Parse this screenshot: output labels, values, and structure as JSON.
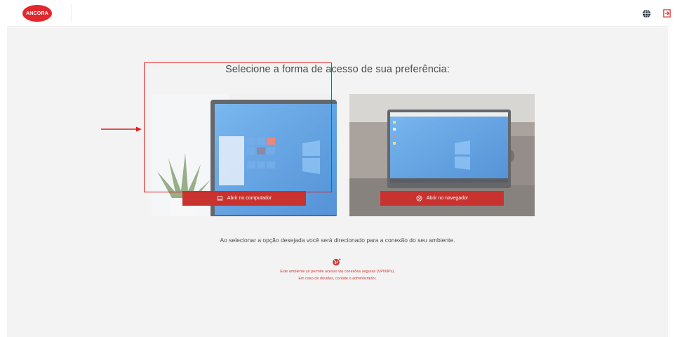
{
  "header": {
    "logo_text": "ANCORA",
    "language_icon": "globe-icon",
    "logout_icon": "logout-icon"
  },
  "main": {
    "heading": "Selecione a forma de acesso de sua preferência:",
    "options": [
      {
        "button_label": "Abrir no computador",
        "icon": "laptop-icon",
        "selected": true
      },
      {
        "button_label": "Abrir no navegador",
        "icon": "browser-globe-icon",
        "selected": false
      }
    ],
    "info_text": "Ao selecionar a opção desejada você será direcionado para a conexão do seu ambiente.",
    "warning_icon": "vpn-globe-icon",
    "warning_line1": "Este ambiente só permite acesso via conexões seguras (VPN/IPs).",
    "warning_line2": "Em caso de dúvidas, contate o administrador."
  },
  "colors": {
    "brand_red": "#c8332f",
    "highlight_red": "#e01f1f",
    "background": "#f3f3f3",
    "windows_blue": "#1f7fd8"
  }
}
